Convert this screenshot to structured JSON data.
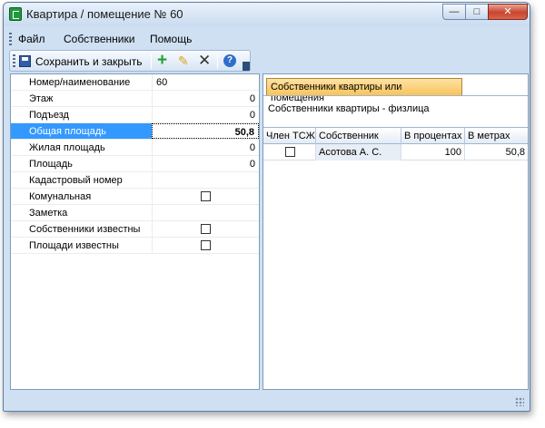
{
  "window": {
    "title": "Квартира / помещение № 60"
  },
  "menu": {
    "items": [
      "Файл",
      "Собственники",
      "Помощь"
    ]
  },
  "toolbar": {
    "save_label": "Сохранить и закрыть",
    "icons": [
      "save-icon",
      "add-icon",
      "edit-icon",
      "delete-icon",
      "help-icon"
    ]
  },
  "properties": [
    {
      "name": "Номер/наименование",
      "value": "60",
      "type": "text"
    },
    {
      "name": "Этаж",
      "value": "0",
      "type": "number"
    },
    {
      "name": "Подъезд",
      "value": "0",
      "type": "number"
    },
    {
      "name": "Общая площадь",
      "value": "50,8",
      "type": "number",
      "selected": true
    },
    {
      "name": "Жилая площадь",
      "value": "0",
      "type": "number"
    },
    {
      "name": "Площадь",
      "value": "0",
      "type": "number"
    },
    {
      "name": "Кадастровый номер",
      "value": "",
      "type": "text"
    },
    {
      "name": "Комунальная",
      "checked": false,
      "type": "checkbox"
    },
    {
      "name": "Заметка",
      "value": "",
      "type": "text"
    },
    {
      "name": "Собственники известны",
      "checked": false,
      "type": "checkbox"
    },
    {
      "name": "Площади известны",
      "checked": false,
      "type": "checkbox"
    }
  ],
  "owners_panel": {
    "tab_label": "Собственники квартиры или помещения",
    "subtitle": "Собственники квартиры - физлица",
    "columns": [
      "Член ТСЖ",
      "Собственник",
      "В процентах",
      "В метрах"
    ],
    "rows": [
      {
        "member": false,
        "owner": "Асотова А. С.",
        "percent": "100",
        "meters": "50,8"
      }
    ]
  },
  "colors": {
    "selection": "#3399ff",
    "tab": "#f9c45a",
    "window_frame": "#cfe0f3"
  }
}
